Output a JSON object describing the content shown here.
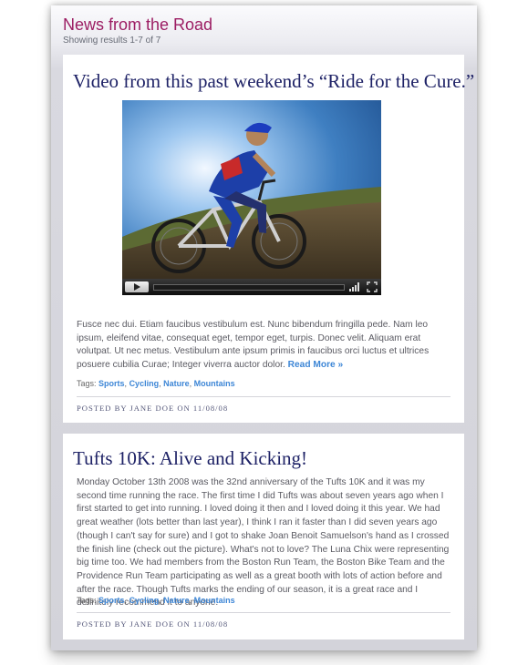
{
  "site": {
    "title": "News from the Road",
    "results_text": "Showing results 1-7 of 7"
  },
  "posts": [
    {
      "title": "Video from this past weekend’s “Ride for the Cure.”",
      "excerpt": "Fusce nec dui. Etiam faucibus vestibulum est. Nunc bibendum fringilla pede. Nam leo ipsum, eleifend vitae, consequat eget, tempor eget, turpis. Donec velit. Aliquam erat volutpat. Ut nec metus. Vestibulum ante ipsum primis in faucibus orci luctus et ultrices posuere cubilia Curae; Integer viverra auctor dolor.",
      "read_more": "Read More »",
      "tags_label": "Tags:",
      "tags": [
        "Sports",
        "Cycling",
        "Nature",
        "Mountains"
      ],
      "byline": "POSTED BY JANE DOE ON 11/08/08",
      "video": {
        "icons": [
          "play-icon",
          "volume-icon",
          "fullscreen-icon"
        ]
      }
    },
    {
      "title": "Tufts 10K: Alive and Kicking!",
      "body": "Monday October 13th 2008 was the 32nd anniversary of the Tufts 10K and it was my second time running the race. The first time I did Tufts was about seven years ago when I first started to get into running. I loved doing it then and I loved doing it this year. We had great weather (lots better than last year), I think I ran it faster than I did seven years ago (though I can't say for sure) and I got to shake Joan Benoit Samuelson's hand as I crossed the finish line (check out the picture). What's not to love? The Luna Chix were representing big time too. We had members from the Boston Run Team, the Boston Bike Team and the Providence Run Team participating as well as a great booth with lots of action before and after the race. Though Tufts marks the ending of our season, it is a great race and I definitely recommend it to anyone.",
      "tags_label": "Tags:",
      "tags": [
        "Sports",
        "Cycling",
        "Nature",
        "Mountains"
      ],
      "byline": "POSTED BY JANE DOE ON 11/08/08"
    }
  ],
  "colors": {
    "site_title": "#9c1d63",
    "post_title": "#1e2266",
    "link": "#3d86d6"
  }
}
